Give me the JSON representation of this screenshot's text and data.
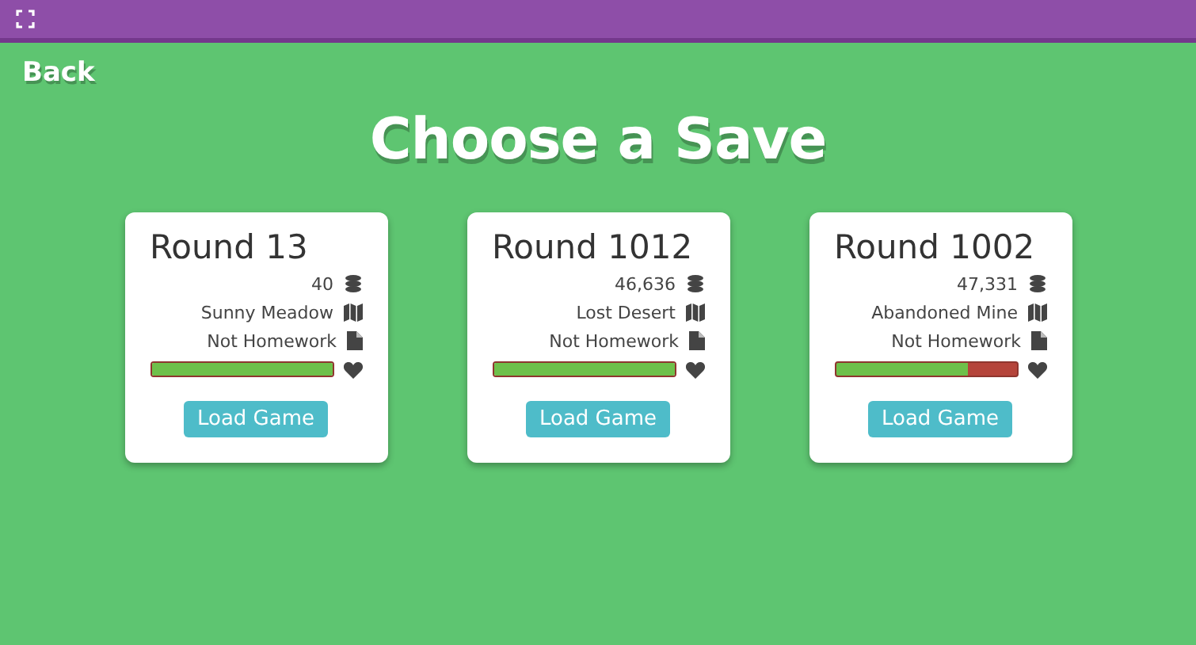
{
  "back": "Back",
  "title": "Choose a Save",
  "saves": [
    {
      "round": "Round 13",
      "coins": "40",
      "location": "Sunny Meadow",
      "mode": "Not Homework",
      "level": 1,
      "button": "Load Game"
    },
    {
      "round": "Round 1012",
      "coins": "46,636",
      "location": "Lost Desert",
      "mode": "Not Homework",
      "level": 1,
      "button": "Load Game"
    },
    {
      "round": "Round 1002",
      "coins": "47,331",
      "location": "Abandoned Mine",
      "mode": "Not Homework",
      "level": 0.73,
      "button": "Load Game"
    }
  ]
}
